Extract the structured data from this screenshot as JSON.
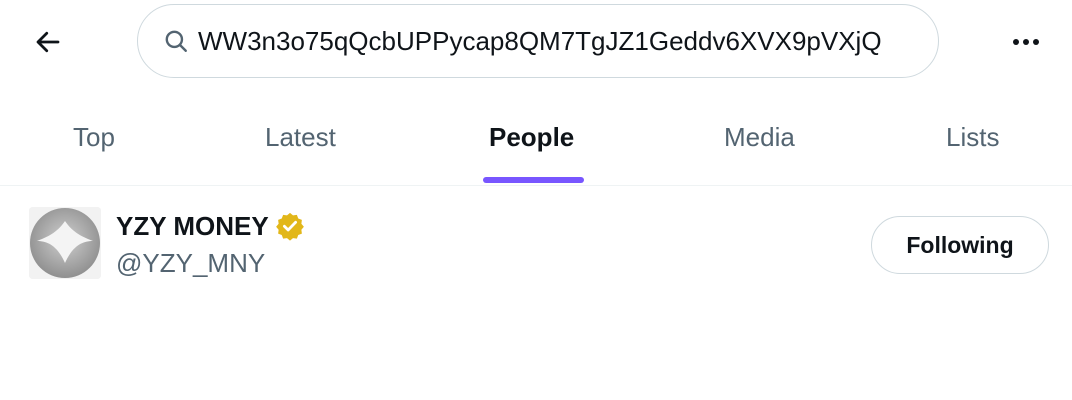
{
  "header": {
    "back_icon": "arrow-left-icon",
    "search": {
      "icon": "search-icon",
      "value": "WW3n3o75qQcbUPPycap8QM7TgJZ1Geddv6XVX9pVXjQ"
    },
    "more_icon": "more-horizontal-icon"
  },
  "tabs": [
    {
      "label": "Top",
      "active": false
    },
    {
      "label": "Latest",
      "active": false
    },
    {
      "label": "People",
      "active": true
    },
    {
      "label": "Media",
      "active": false
    },
    {
      "label": "Lists",
      "active": false
    }
  ],
  "results": [
    {
      "display_name": "YZY MONEY",
      "verified": true,
      "verified_icon": "gold-verified-badge-icon",
      "handle": "@YZY_MNY",
      "follow_label": "Following"
    }
  ],
  "colors": {
    "accent": "#7856ff",
    "verified_gold": "#e2b719",
    "text_primary": "#0f1419",
    "text_secondary": "#536471",
    "border": "#cfd9de"
  }
}
